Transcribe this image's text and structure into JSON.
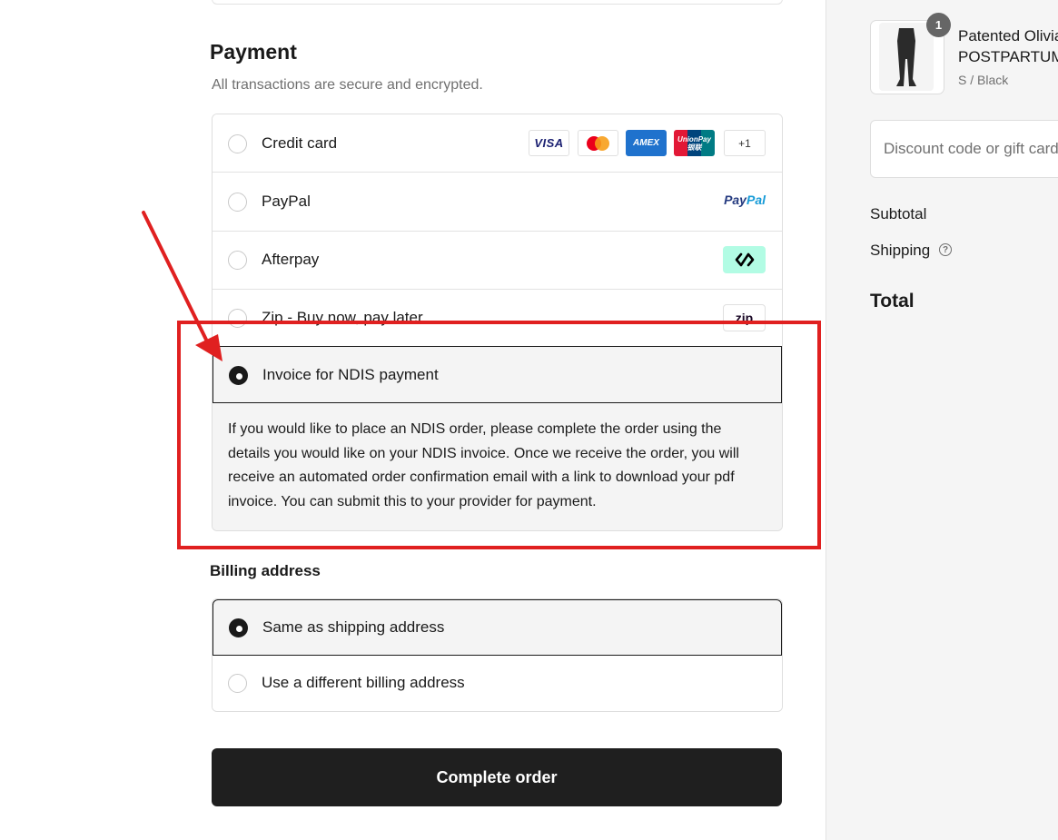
{
  "payment": {
    "title": "Payment",
    "subtitle": "All transactions are secure and encrypted.",
    "methods": [
      {
        "label": "Credit card",
        "selected": false
      },
      {
        "label": "PayPal",
        "selected": false
      },
      {
        "label": "Afterpay",
        "selected": false
      },
      {
        "label": "Zip - Buy now, pay later",
        "selected": false
      },
      {
        "label": "Invoice for NDIS payment",
        "selected": true
      }
    ],
    "card_logos": {
      "visa": "VISA",
      "amex": "AMEX",
      "unionpay_en": "UnionPay",
      "unionpay_cn": "银联",
      "more": "+1"
    },
    "paypal_logo": {
      "part1": "Pay",
      "part2": "Pal"
    },
    "zip_logo": "zip",
    "ndis_description": "If you would like to place an NDIS order, please complete the order using the details you would like on your NDIS invoice. Once we receive the order, you will receive an automated order confirmation email with a link to download your pdf invoice. You can submit this to your provider for payment."
  },
  "billing": {
    "title": "Billing address",
    "options": [
      {
        "label": "Same as shipping address",
        "selected": true
      },
      {
        "label": "Use a different billing address",
        "selected": false
      }
    ]
  },
  "complete_button": "Complete order",
  "sidebar": {
    "product": {
      "quantity": "1",
      "name": "Patented Olivia POSTPARTUM",
      "variant": "S / Black"
    },
    "discount_placeholder": "Discount code or gift card",
    "subtotal_label": "Subtotal",
    "shipping_label": "Shipping",
    "total_label": "Total"
  },
  "annotation": {
    "color": "#e02020"
  },
  "colors": {
    "primary": "#1f1f1f",
    "selected_bg": "#f4f4f4",
    "muted_text": "#707070"
  }
}
